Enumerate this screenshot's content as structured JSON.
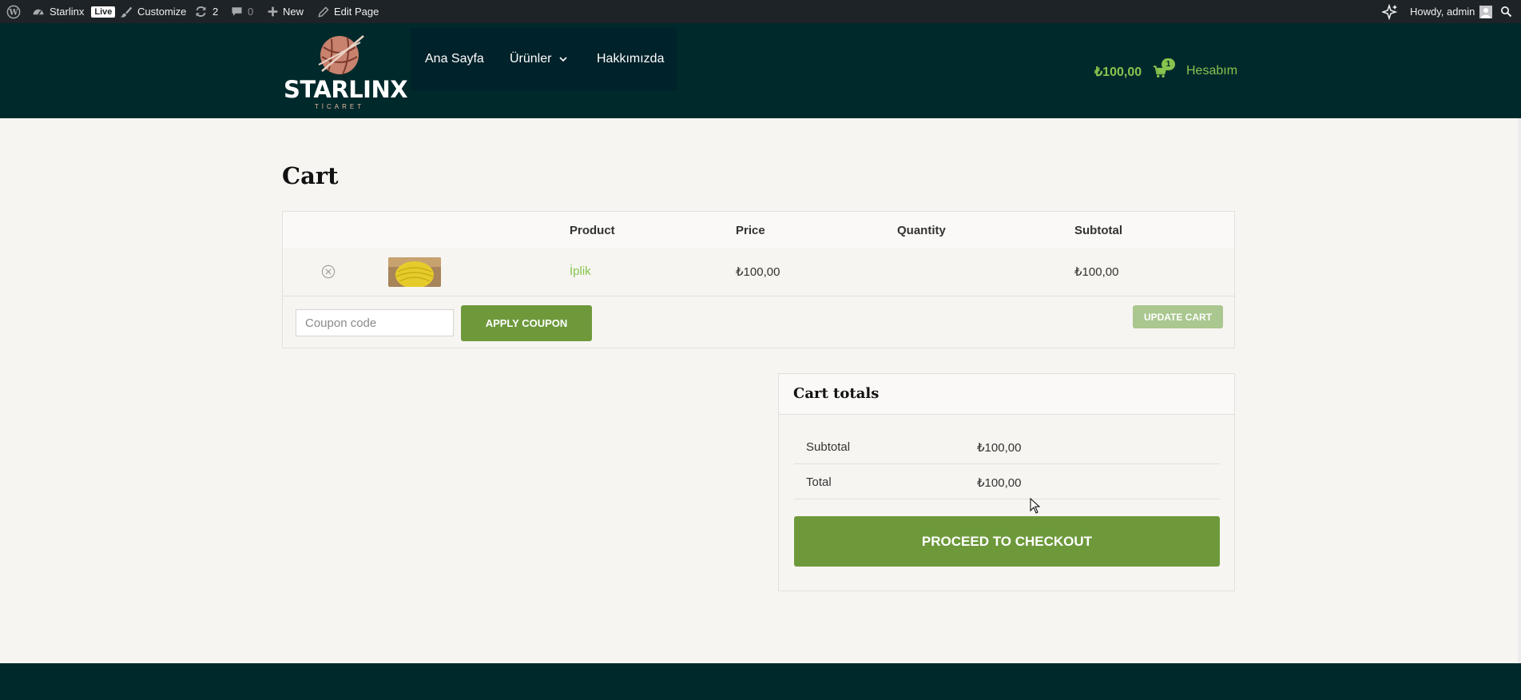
{
  "admin_bar": {
    "site_name": "Starlinx",
    "live_badge": "Live",
    "customize": "Customize",
    "updates_count": "2",
    "comments_count": "0",
    "new_label": "New",
    "edit_page": "Edit Page",
    "greeting": "Howdy, admin"
  },
  "header": {
    "logo_text": "STARLINX",
    "logo_subtext": "TİCARET",
    "nav": [
      "Ana Sayfa",
      "Ürünler",
      "Hakkımızda"
    ],
    "cart_amount": "₺100,00",
    "cart_count": "1",
    "account_link": "Hesabım"
  },
  "page": {
    "title": "Cart"
  },
  "cart_table": {
    "headers": {
      "product": "Product",
      "price": "Price",
      "quantity": "Quantity",
      "subtotal": "Subtotal"
    },
    "items": [
      {
        "product": "İplik",
        "price": "₺100,00",
        "quantity": "",
        "subtotal": "₺100,00"
      }
    ],
    "coupon_placeholder": "Coupon code",
    "apply_coupon": "APPLY COUPON",
    "update_cart": "UPDATE CART"
  },
  "cart_totals": {
    "title": "Cart totals",
    "subtotal_label": "Subtotal",
    "subtotal_value": "₺100,00",
    "total_label": "Total",
    "total_value": "₺100,00",
    "checkout_button": "PROCEED TO CHECKOUT"
  },
  "colors": {
    "admin_bar": "#1d2327",
    "header": "#00292b",
    "accent_green": "#6d993b",
    "link_green": "#86c44e",
    "page_background": "#f7f5f1"
  },
  "icons": [
    "wordpress-icon",
    "dashboard-icon",
    "brush-icon",
    "updates-icon",
    "comment-icon",
    "plus-icon",
    "pencil-icon",
    "sparkle-icon",
    "user-avatar",
    "search-icon",
    "cart-icon",
    "remove-icon",
    "chevron-down-icon"
  ]
}
